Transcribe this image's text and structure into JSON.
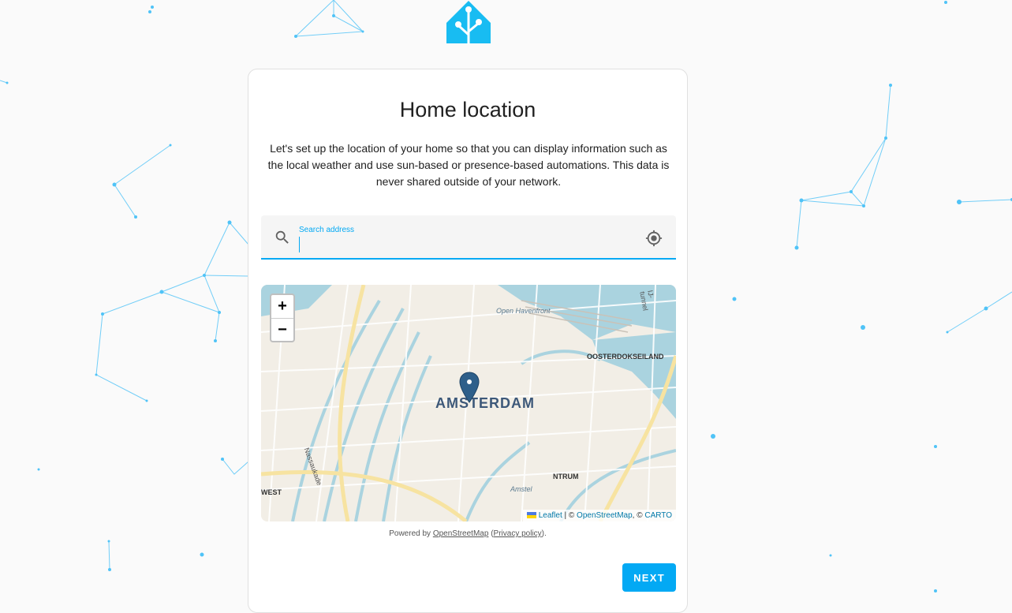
{
  "page": {
    "title": "Home location",
    "description": "Let's set up the location of your home so that you can display information such as the local weather and use sun-based or presence-based automations. This data is never shared outside of your network."
  },
  "search": {
    "label": "Search address",
    "value": "",
    "search_icon": "magnify-icon",
    "location_icon": "crosshairs-gps-icon"
  },
  "map": {
    "zoom_in": "+",
    "zoom_out": "−",
    "city_label": "AMSTERDAM",
    "labels": {
      "open_havenfront": "Open Havenfront",
      "oosterdokseiland": "OOSTERDOKSEILAND",
      "nassaukade": "Nassaukade",
      "west": "WEST",
      "centrum": "NTRUM",
      "amstel": "Amstel",
      "ij_tunnel": "IJ-tunnel"
    },
    "attribution": {
      "leaflet": "Leaflet",
      "separator": " | © ",
      "osm": "OpenStreetMap",
      "comma": ", © ",
      "carto": "CARTO"
    }
  },
  "powered": {
    "prefix": "Powered by ",
    "osm_link": "OpenStreetMap",
    "paren_open": " (",
    "privacy_link": "Privacy policy",
    "paren_close": ")."
  },
  "actions": {
    "next_label": "NEXT"
  },
  "colors": {
    "accent": "#03a9f4",
    "marker": "#2e5f8a"
  }
}
